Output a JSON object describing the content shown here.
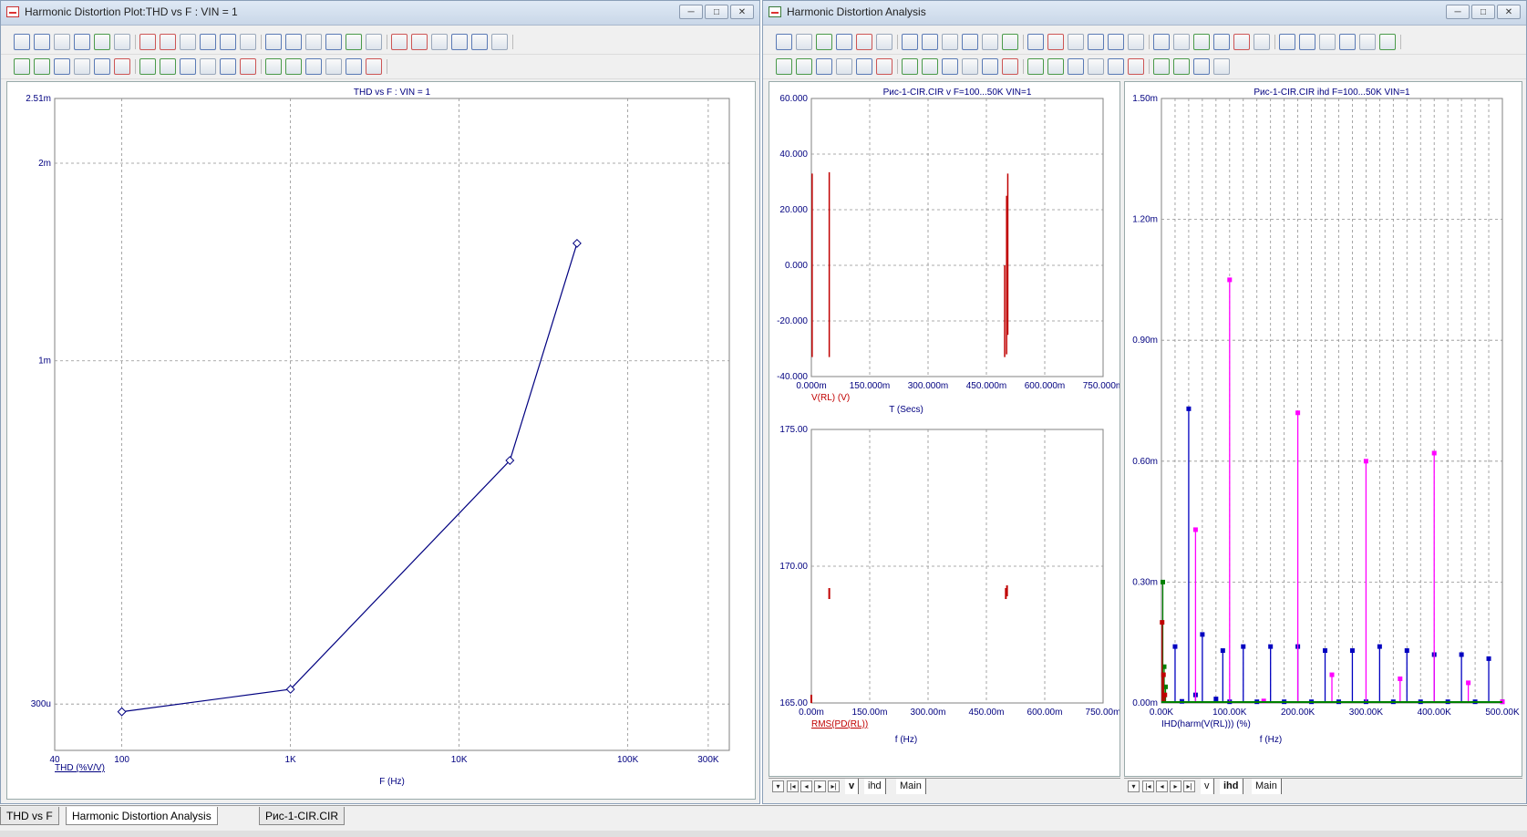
{
  "windows": {
    "left": {
      "title": "Harmonic Distortion Plot:THD vs F : VIN = 1"
    },
    "right": {
      "title": "Harmonic Distortion Analysis"
    },
    "controls": {
      "minimize": "─",
      "maximize": "□",
      "close": "✕"
    }
  },
  "bottom_tabs": [
    {
      "label": "THD vs F",
      "active": false
    },
    {
      "label": "Harmonic Distortion Analysis",
      "active": true
    },
    {
      "label": "Рис-1-CIR.CIR",
      "active": false
    }
  ],
  "plot_tabs_mid": [
    {
      "label": "v",
      "active": true
    },
    {
      "label": "ihd",
      "active": false
    },
    {
      "label": "Main",
      "active": false
    }
  ],
  "plot_tabs_right": [
    {
      "label": "v",
      "active": false
    },
    {
      "label": "ihd",
      "active": true
    },
    {
      "label": "Main",
      "active": false
    }
  ],
  "colors": {
    "blue": "#0000c0",
    "red": "#c00000",
    "magenta": "#ff00ff",
    "green": "#008000",
    "darkblue": "#000080",
    "grid": "#808080"
  },
  "chart_data": [
    {
      "type": "line",
      "title": "THD vs F : VIN = 1",
      "xlabel": "F (Hz)",
      "ylabel": "THD (%V/V)",
      "x_scale": "log",
      "y_scale": "log",
      "xlim": [
        40,
        400000
      ],
      "ylim": [
        0.000255,
        0.00251
      ],
      "x_ticks": [
        {
          "v": 40,
          "t": "40"
        },
        {
          "v": 100,
          "t": "100"
        },
        {
          "v": 1000,
          "t": "1K"
        },
        {
          "v": 10000,
          "t": "10K"
        },
        {
          "v": 100000,
          "t": "100K"
        },
        {
          "v": 300000,
          "t": "300K"
        }
      ],
      "y_ticks": [
        {
          "v": 0.0003,
          "t": "300u"
        },
        {
          "v": 0.001,
          "t": "1m"
        },
        {
          "v": 0.002,
          "t": "2m"
        },
        {
          "v": 0.00251,
          "t": "2.51m"
        }
      ],
      "x_grid": [
        100,
        1000,
        10000,
        100000,
        300000
      ],
      "y_grid": [
        0.0003,
        0.001,
        0.002
      ],
      "series": [
        {
          "name": "",
          "color": "#000080",
          "x": [
            100,
            1000,
            20000,
            50000
          ],
          "y": [
            0.000292,
            0.000316,
            0.000705,
            0.00151
          ]
        }
      ]
    },
    {
      "type": "line",
      "title": "Рис-1-CIR.CIR v F=100...50K VIN=1",
      "xlabel": "T (Secs)",
      "ylabel": "V(RL) (V)",
      "xlim": [
        0,
        750
      ],
      "ylim": [
        -40,
        60
      ],
      "x_ticks": [
        {
          "v": 0,
          "t": "0.000m"
        },
        {
          "v": 150,
          "t": "150.000m"
        },
        {
          "v": 300,
          "t": "300.000m"
        },
        {
          "v": 450,
          "t": "450.000m"
        },
        {
          "v": 600,
          "t": "600.000m"
        },
        {
          "v": 750,
          "t": "750.000m"
        }
      ],
      "y_ticks": [
        {
          "v": -40,
          "t": "-40.000"
        },
        {
          "v": -20,
          "t": "-20.000"
        },
        {
          "v": 0,
          "t": "0.000"
        },
        {
          "v": 20,
          "t": "20.000"
        },
        {
          "v": 40,
          "t": "40.000"
        },
        {
          "v": 60,
          "t": "60.000"
        }
      ],
      "x_grid": [
        150,
        300,
        450,
        600
      ],
      "y_grid": [
        -20,
        0,
        20,
        40
      ],
      "bursts": [
        {
          "x": 2,
          "ymin": -33,
          "ymax": 33
        },
        {
          "x": 46,
          "ymin": -33,
          "ymax": 33.5
        },
        {
          "x": 497,
          "ymin": -33,
          "ymax": 0
        },
        {
          "x": 502,
          "ymin": -32,
          "ymax": 25
        },
        {
          "x": 505,
          "ymin": -25,
          "ymax": 33
        }
      ]
    },
    {
      "type": "scatter",
      "title": "",
      "xlabel": "f (Hz)",
      "ylabel": "RMS(PD(RL))",
      "xlim": [
        0,
        750
      ],
      "ylim": [
        165,
        175
      ],
      "x_ticks": [
        {
          "v": 0,
          "t": "0.00m"
        },
        {
          "v": 150,
          "t": "150.00m"
        },
        {
          "v": 300,
          "t": "300.00m"
        },
        {
          "v": 450,
          "t": "450.00m"
        },
        {
          "v": 600,
          "t": "600.00m"
        },
        {
          "v": 750,
          "t": "750.00m"
        }
      ],
      "y_ticks": [
        {
          "v": 165,
          "t": "165.00"
        },
        {
          "v": 170,
          "t": "170.00"
        },
        {
          "v": 175,
          "t": "175.00"
        }
      ],
      "x_grid": [
        150,
        300,
        450,
        600
      ],
      "y_grid": [
        170
      ],
      "marks": [
        {
          "x": 46,
          "y0": 168.8,
          "y1": 169.2
        },
        {
          "x": 500,
          "y0": 168.8,
          "y1": 169.2
        },
        {
          "x": 503,
          "y0": 168.9,
          "y1": 169.3
        },
        {
          "x": 0,
          "y0": 165.0,
          "y1": 165.3
        }
      ]
    },
    {
      "type": "bar",
      "title": "Рис-1-CIR.CIR ihd F=100...50K VIN=1",
      "xlabel": "f (Hz)",
      "ylabel": "IHD(harm(V(RL))) (%)",
      "xlim": [
        0,
        500
      ],
      "ylim": [
        0,
        1.5
      ],
      "x_ticks": [
        {
          "v": 0,
          "t": "0.00K"
        },
        {
          "v": 100,
          "t": "100.00K"
        },
        {
          "v": 200,
          "t": "200.00K"
        },
        {
          "v": 300,
          "t": "300.00K"
        },
        {
          "v": 400,
          "t": "400.00K"
        },
        {
          "v": 500,
          "t": "500.00K"
        }
      ],
      "y_ticks": [
        {
          "v": 0,
          "t": "0.00m"
        },
        {
          "v": 0.3,
          "t": "0.30m"
        },
        {
          "v": 0.6,
          "t": "0.60m"
        },
        {
          "v": 0.9,
          "t": "0.90m"
        },
        {
          "v": 1.2,
          "t": "1.20m"
        },
        {
          "v": 1.5,
          "t": "1.50m"
        }
      ],
      "x_grid": [
        20,
        40,
        60,
        80,
        100,
        120,
        140,
        160,
        180,
        200,
        220,
        240,
        260,
        280,
        300,
        320,
        340,
        360,
        380,
        400,
        420,
        440,
        460,
        480
      ],
      "y_grid": [
        0.3,
        0.6,
        0.9,
        1.2
      ],
      "series": [
        {
          "name": "",
          "color": "#0000c0",
          "x": [
            20,
            30,
            40,
            50,
            60,
            80,
            90,
            100,
            120,
            140,
            160,
            180,
            200,
            220,
            240,
            260,
            280,
            300,
            320,
            340,
            360,
            380,
            400,
            420,
            440,
            460,
            480,
            500
          ],
          "y": [
            0.14,
            0.004,
            0.73,
            0.02,
            0.17,
            0.01,
            0.13,
            0.003,
            0.14,
            0.003,
            0.14,
            0.003,
            0.14,
            0.003,
            0.13,
            0.003,
            0.13,
            0.003,
            0.14,
            0.003,
            0.13,
            0.003,
            0.12,
            0.003,
            0.12,
            0.003,
            0.11,
            0.003
          ]
        },
        {
          "name": "",
          "color": "#ff00ff",
          "x": [
            50,
            100,
            150,
            200,
            250,
            300,
            350,
            400,
            450,
            500
          ],
          "y": [
            0.43,
            1.05,
            0.005,
            0.72,
            0.07,
            0.6,
            0.06,
            0.62,
            0.05,
            0.003
          ]
        },
        {
          "name": "",
          "color": "#008000",
          "x": [
            2,
            4,
            6
          ],
          "y": [
            0.3,
            0.09,
            0.04
          ]
        },
        {
          "name": "",
          "color": "#c00000",
          "x": [
            1,
            3,
            5
          ],
          "y": [
            0.2,
            0.07,
            0.02
          ]
        }
      ]
    }
  ]
}
